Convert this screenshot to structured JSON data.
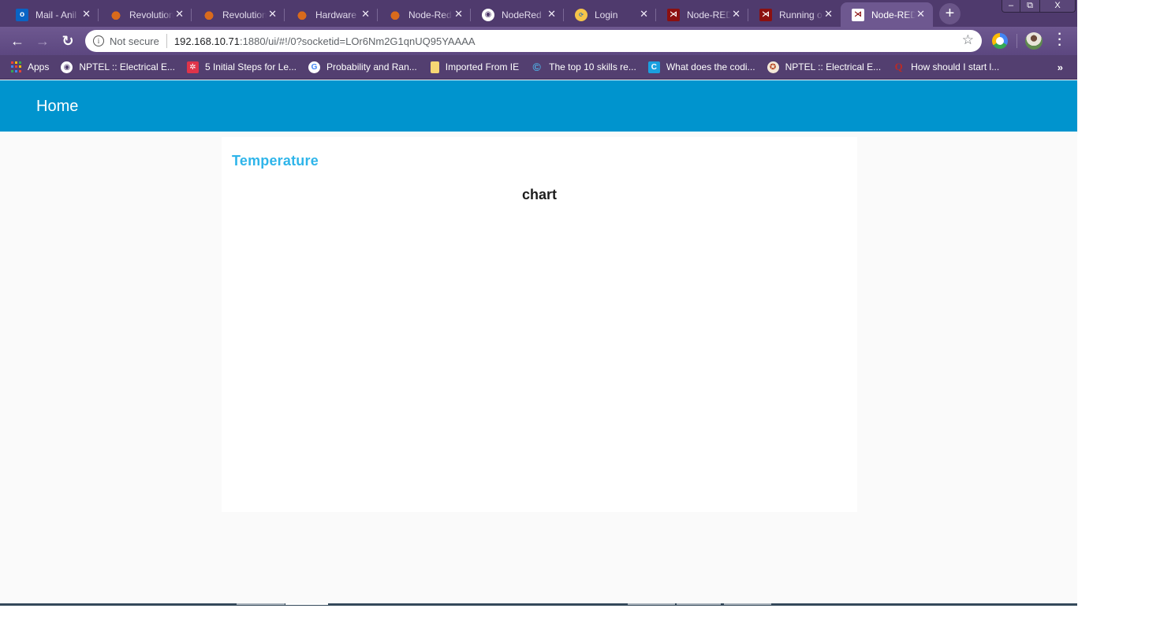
{
  "browser": {
    "tabs": [
      {
        "label": "Mail - Anil",
        "icon": "outlook-icon"
      },
      {
        "label": "Revolution",
        "icon": "raspberry-icon"
      },
      {
        "label": "Revolution",
        "icon": "raspberry-icon"
      },
      {
        "label": "Hardware",
        "icon": "raspberry-icon"
      },
      {
        "label": "Node-Red",
        "icon": "raspberry-icon"
      },
      {
        "label": "NodeRed",
        "icon": "globe-icon"
      },
      {
        "label": "Login",
        "icon": "login-icon"
      },
      {
        "label": "Node-RED",
        "icon": "node-red-icon"
      },
      {
        "label": "Running o",
        "icon": "node-red-icon"
      },
      {
        "label": "Node-RED",
        "icon": "node-red-icon",
        "active": true
      }
    ],
    "new_tab_label": "+",
    "window_controls": {
      "minimize": "–",
      "restore": "⧉",
      "close": "X"
    },
    "toolbar": {
      "back": "←",
      "forward": "→",
      "reload": "↻",
      "security_icon": "i",
      "security_label": "Not secure",
      "url_host": "192.168.10.71",
      "url_path": ":1880/ui/#!/0?socketid=LOr6Nm2G1qnUQ95YAAAA",
      "bookmark_star": "☆",
      "menu": "⋮"
    },
    "bookmarks": [
      {
        "label": "Apps",
        "icon": "apps-grid-icon"
      },
      {
        "label": "NPTEL :: Electrical E...",
        "icon": "globe-icon"
      },
      {
        "label": "5 Initial Steps for Le...",
        "icon": "gear-bookmark-icon"
      },
      {
        "label": "Probability and Ran...",
        "icon": "google-icon"
      },
      {
        "label": "Imported From IE",
        "icon": "folder-icon"
      },
      {
        "label": "The top 10 skills re...",
        "icon": "spiral-icon"
      },
      {
        "label": "What does the codi...",
        "icon": "codecademy-icon"
      },
      {
        "label": "NPTEL :: Electrical E...",
        "icon": "nptel-icon"
      },
      {
        "label": "How should I start l...",
        "icon": "quora-icon"
      }
    ],
    "bookmarks_more": "»"
  },
  "dashboard": {
    "header_title": "Home",
    "header_color": "#0094ce",
    "group": {
      "title": "Temperature",
      "title_color": "#2fb5ea",
      "widget_label": "chart"
    }
  }
}
